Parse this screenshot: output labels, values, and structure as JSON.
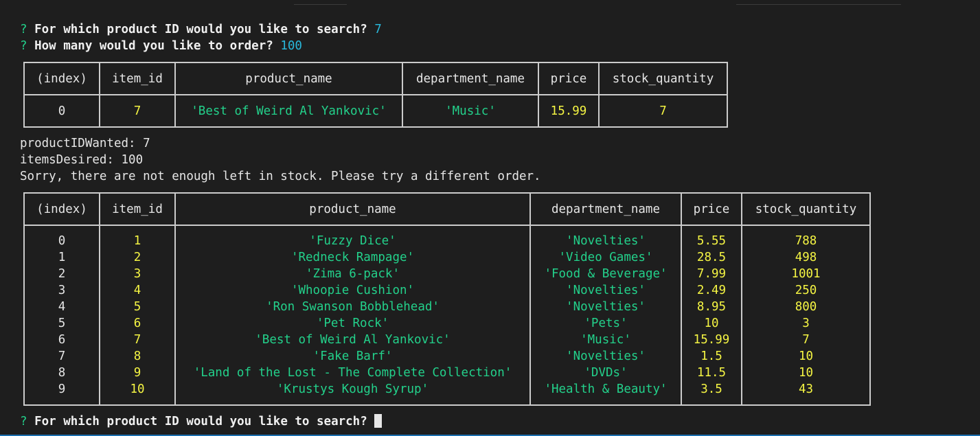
{
  "prompt_symbol": "?",
  "prompts": {
    "search_question": "For which product ID would you like to search?",
    "search_answer": "7",
    "order_question": "How many would you like to order?",
    "order_answer": "100"
  },
  "table1": {
    "headers": [
      "(index)",
      "item_id",
      "product_name",
      "department_name",
      "price",
      "stock_quantity"
    ],
    "row": {
      "index": "0",
      "item_id": "7",
      "product_name": "'Best of Weird Al Yankovic'",
      "department_name": "'Music'",
      "price": "15.99",
      "stock_quantity": "7"
    }
  },
  "log": {
    "product_id_line": "productIDWanted: 7",
    "items_desired_line": "itemsDesired: 100",
    "message": "Sorry, there are not enough left in stock. Please try a different order."
  },
  "table2": {
    "headers": [
      "(index)",
      "item_id",
      "product_name",
      "department_name",
      "price",
      "stock_quantity"
    ],
    "rows": [
      {
        "index": "0",
        "item_id": "1",
        "product_name": "'Fuzzy Dice'",
        "department_name": "'Novelties'",
        "price": "5.55",
        "stock_quantity": "788"
      },
      {
        "index": "1",
        "item_id": "2",
        "product_name": "'Redneck Rampage'",
        "department_name": "'Video Games'",
        "price": "28.5",
        "stock_quantity": "498"
      },
      {
        "index": "2",
        "item_id": "3",
        "product_name": "'Zima 6-pack'",
        "department_name": "'Food & Beverage'",
        "price": "7.99",
        "stock_quantity": "1001"
      },
      {
        "index": "3",
        "item_id": "4",
        "product_name": "'Whoopie Cushion'",
        "department_name": "'Novelties'",
        "price": "2.49",
        "stock_quantity": "250"
      },
      {
        "index": "4",
        "item_id": "5",
        "product_name": "'Ron Swanson Bobblehead'",
        "department_name": "'Novelties'",
        "price": "8.95",
        "stock_quantity": "800"
      },
      {
        "index": "5",
        "item_id": "6",
        "product_name": "'Pet Rock'",
        "department_name": "'Pets'",
        "price": "10",
        "stock_quantity": "3"
      },
      {
        "index": "6",
        "item_id": "7",
        "product_name": "'Best of Weird Al Yankovic'",
        "department_name": "'Music'",
        "price": "15.99",
        "stock_quantity": "7"
      },
      {
        "index": "7",
        "item_id": "8",
        "product_name": "'Fake Barf'",
        "department_name": "'Novelties'",
        "price": "1.5",
        "stock_quantity": "10"
      },
      {
        "index": "8",
        "item_id": "9",
        "product_name": "'Land of the Lost - The Complete Collection'",
        "department_name": "'DVDs'",
        "price": "11.5",
        "stock_quantity": "10"
      },
      {
        "index": "9",
        "item_id": "10",
        "product_name": "'Krustys Kough Syrup'",
        "department_name": "'Health & Beauty'",
        "price": "3.5",
        "stock_quantity": "43"
      }
    ]
  },
  "final_prompt": {
    "question": "For which product ID would you like to search?"
  },
  "colors": {
    "background": "#1e1e1e",
    "prompt_green": "#23d18b",
    "answer_cyan": "#29b8db",
    "number_yellow": "#f5f543",
    "border": "#cccccc"
  }
}
